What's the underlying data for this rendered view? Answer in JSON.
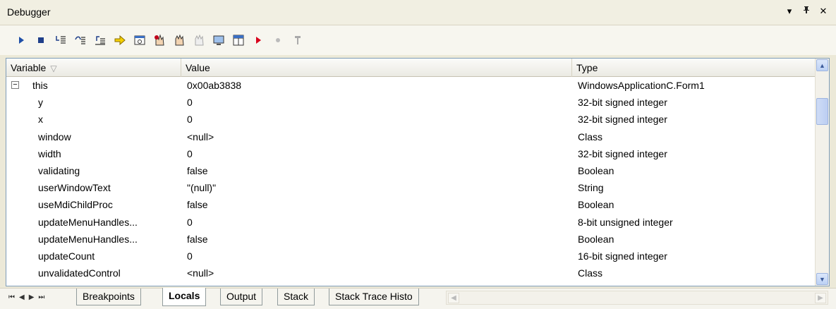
{
  "window": {
    "title": "Debugger",
    "dropdown_glyph": "▾",
    "pin_glyph": "ᵽ",
    "close_glyph": "✕"
  },
  "toolbar": {
    "icons": [
      "continue-icon",
      "stop-icon",
      "step-into-icon",
      "step-over-icon",
      "step-out-icon",
      "run-to-cursor-icon",
      "watch-window-icon",
      "breakpoint-hand-icon",
      "hand-icon",
      "hand-disabled-icon",
      "screen-icon",
      "window-grid-icon",
      "play-red-icon",
      "dot-disabled-icon",
      "pin-tool-icon"
    ]
  },
  "grid": {
    "columns": [
      {
        "label": "Variable",
        "sort_glyph": "▽"
      },
      {
        "label": "Value"
      },
      {
        "label": "Type"
      }
    ],
    "rows": [
      {
        "variable": "this",
        "value": "0x00ab3838",
        "type": "WindowsApplicationC.Form1",
        "expanded": "⊟"
      },
      {
        "variable": "y",
        "value": "0",
        "type": "32-bit signed integer"
      },
      {
        "variable": "x",
        "value": "0",
        "type": "32-bit signed integer"
      },
      {
        "variable": "window",
        "value": "<null>",
        "type": "Class"
      },
      {
        "variable": "width",
        "value": "0",
        "type": "32-bit signed integer"
      },
      {
        "variable": "validating",
        "value": "false",
        "type": "Boolean"
      },
      {
        "variable": "userWindowText",
        "value": "\"(null)\"",
        "type": "String"
      },
      {
        "variable": "useMdiChildProc",
        "value": "false",
        "type": "Boolean"
      },
      {
        "variable": "updateMenuHandles...",
        "value": "0",
        "type": "8-bit unsigned integer"
      },
      {
        "variable": "updateMenuHandles...",
        "value": "false",
        "type": "Boolean"
      },
      {
        "variable": "updateCount",
        "value": "0",
        "type": "16-bit signed integer"
      },
      {
        "variable": "unvalidatedControl",
        "value": "<null>",
        "type": "Class"
      }
    ]
  },
  "tabs": [
    "Breakpoints",
    "Locals",
    "Output",
    "Stack",
    "Stack Trace Histo"
  ],
  "active_tab": "Locals",
  "nav_glyphs": [
    "⏮",
    "◀",
    "▶",
    "⏭"
  ]
}
